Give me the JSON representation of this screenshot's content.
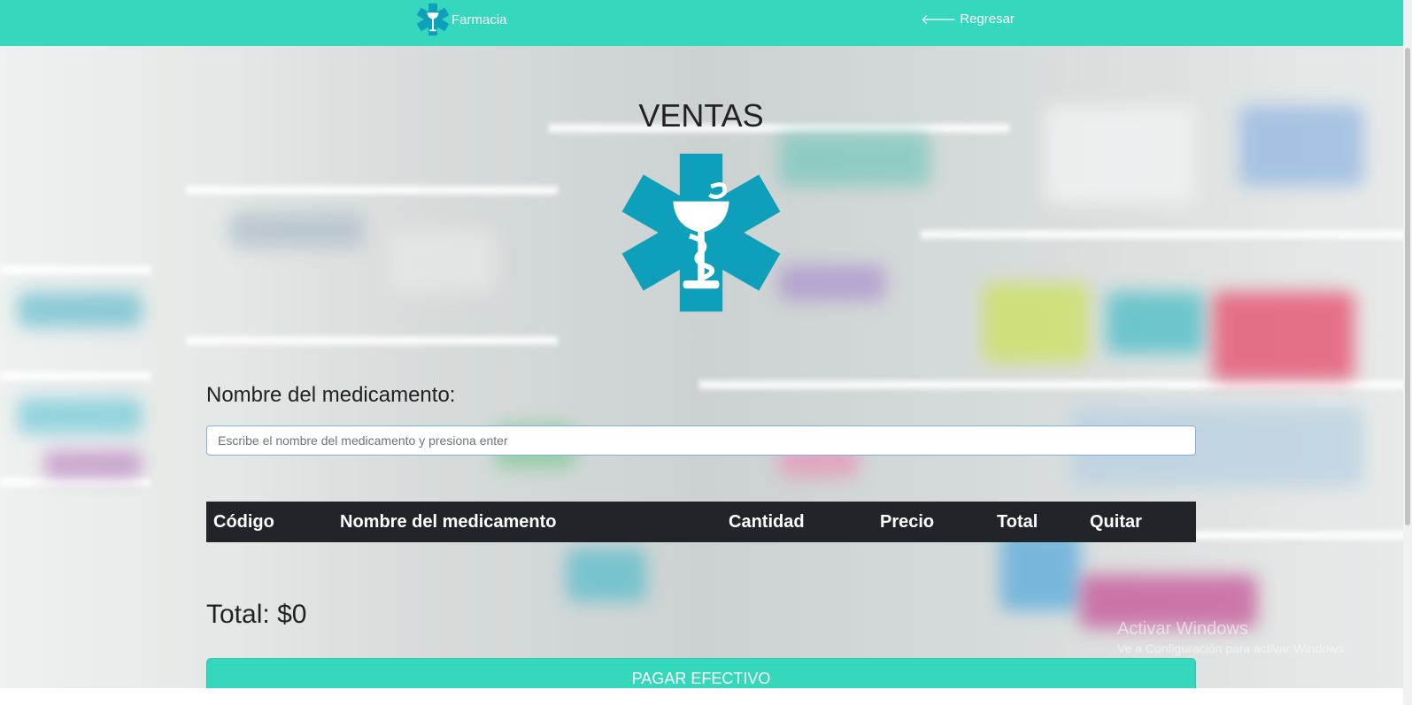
{
  "navbar": {
    "brand_label": "Farmacia",
    "back_label": "Regresar",
    "background_color": "#35d8bd"
  },
  "main": {
    "title": "VENTAS",
    "search_label": "Nombre del medicamento:",
    "search_placeholder": "Escribe el nombre del medicamento y presiona enter",
    "search_value": "",
    "table_headers": [
      "Código",
      "Nombre del medicamento",
      "Cantidad",
      "Precio",
      "Total",
      "Quitar"
    ],
    "table_rows": [],
    "total_label": "Total:",
    "total_value": "$0",
    "pay_button_label": "PAGAR EFECTIVO",
    "accent_color": "#35d8bd",
    "logo_color": "#0e9fbb"
  },
  "watermark": {
    "title": "Activar Windows",
    "subtitle": "Ve a Configuración para activar Windows."
  },
  "icons": {
    "brand": "star-of-life-icon",
    "back": "arrow-left-icon",
    "logo": "star-of-life-logo"
  }
}
